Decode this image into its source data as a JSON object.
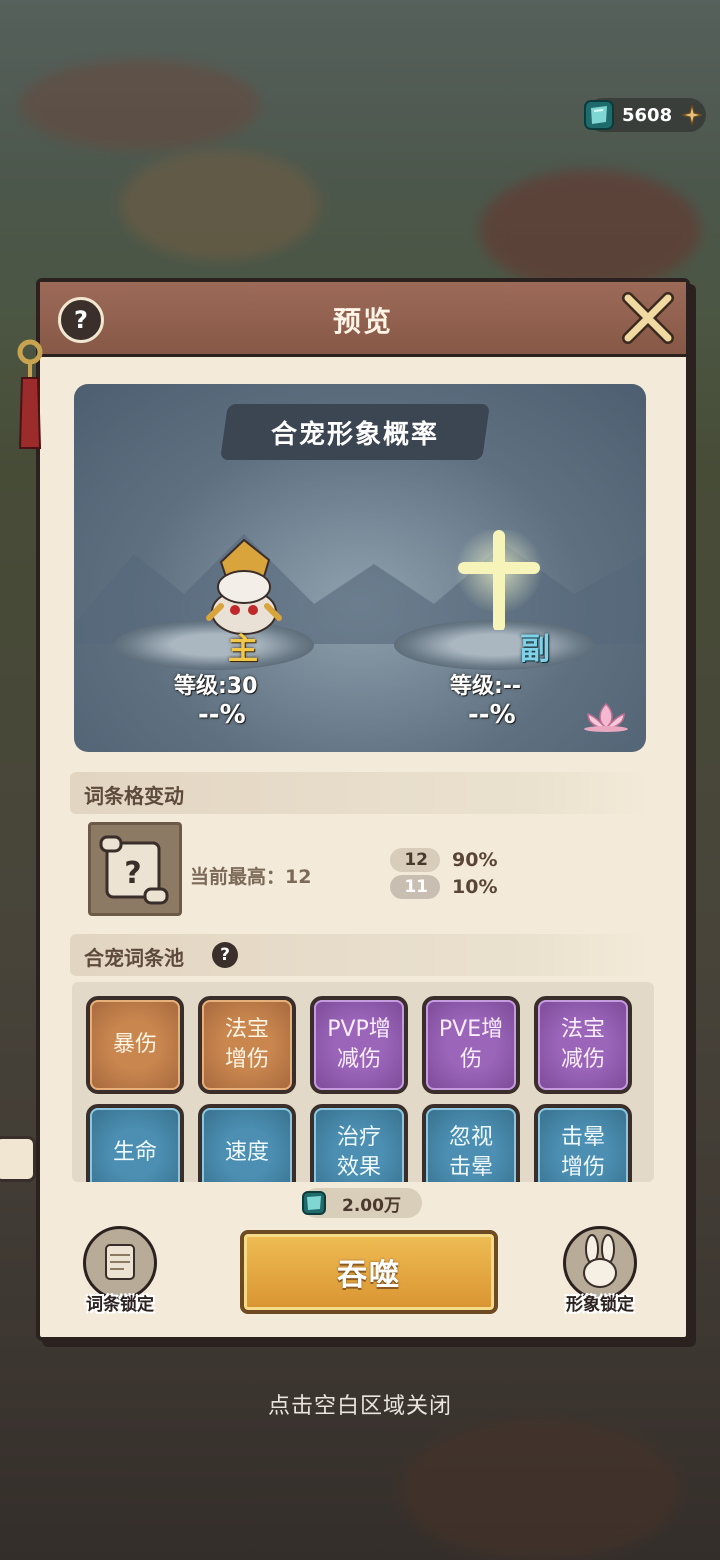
{
  "currency": {
    "icon": "jade-gem-icon",
    "value": "5608",
    "add_icon": "plus-icon"
  },
  "panel": {
    "title": "预览",
    "help_label": "?",
    "close_icon": "close-x-icon"
  },
  "preview": {
    "title": "合宠形象概率",
    "main": {
      "role": "主",
      "level": "等级:30",
      "percent": "--%"
    },
    "sub": {
      "role": "副",
      "level": "等级:--",
      "percent": "--%"
    }
  },
  "affix_slots": {
    "title": "词条格变动",
    "current_max": "当前最高：12",
    "probabilities": [
      {
        "slots": "12",
        "chance": "90%"
      },
      {
        "slots": "11",
        "chance": "10%"
      }
    ]
  },
  "pool": {
    "title": "合宠词条池",
    "help_label": "?",
    "tiles": [
      {
        "lines": [
          "暴伤",
          ""
        ],
        "color": "orange"
      },
      {
        "lines": [
          "法宝",
          "增伤"
        ],
        "color": "orange"
      },
      {
        "lines": [
          "PVP增",
          "减伤"
        ],
        "color": "purple"
      },
      {
        "lines": [
          "PVE增",
          "伤"
        ],
        "color": "purple"
      },
      {
        "lines": [
          "法宝",
          "减伤"
        ],
        "color": "purple"
      },
      {
        "lines": [
          "生命",
          ""
        ],
        "color": "blue"
      },
      {
        "lines": [
          "速度",
          ""
        ],
        "color": "blue"
      },
      {
        "lines": [
          "治疗",
          "效果"
        ],
        "color": "blue"
      },
      {
        "lines": [
          "忽视",
          "击晕"
        ],
        "color": "blue"
      },
      {
        "lines": [
          "击晕",
          "增伤"
        ],
        "color": "blue"
      }
    ]
  },
  "cost": {
    "value": "2.00万"
  },
  "actions": {
    "devour": "吞噬",
    "affix_lock": "词条锁定",
    "appearance_lock": "形象锁定"
  },
  "close_hint": "点击空白区域关闭",
  "colors": {
    "accent": "#e8ac45",
    "header": "#8f5e4b",
    "panel_bg": "#f3ead9"
  }
}
